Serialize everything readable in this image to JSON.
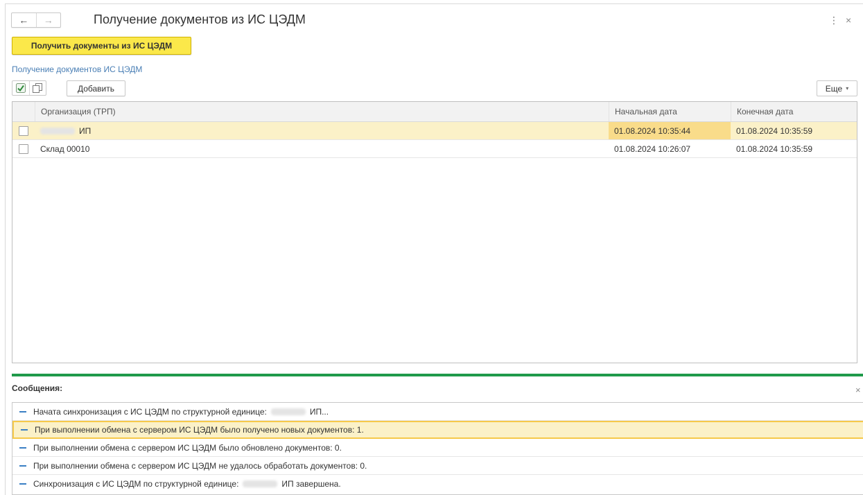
{
  "window": {
    "title": "Получение документов из ИС ЦЭДМ",
    "back_glyph": "←",
    "forward_glyph": "→",
    "more_glyph": "⋮",
    "close_glyph": "×"
  },
  "actions": {
    "main_button": "Получить документы из ИС ЦЭДМ",
    "section_link": "Получение документов ИС ЦЭДМ",
    "add_button": "Добавить",
    "more_button": "Еще",
    "more_caret": "▾"
  },
  "table": {
    "columns": [
      "Организация (ТРП)",
      "Начальная дата",
      "Конечная дата"
    ],
    "rows": [
      {
        "org": "ИП",
        "start": "01.08.2024 10:35:44",
        "end": "01.08.2024 10:35:59",
        "checked": false
      },
      {
        "org": "Склад 00010",
        "start": "01.08.2024 10:26:07",
        "end": "01.08.2024 10:35:59",
        "checked": false
      }
    ]
  },
  "messages": {
    "title": "Сообщения:",
    "close_glyph": "×",
    "items": [
      {
        "pre": "Начата синхронизация с ИС ЦЭДМ по структурной единице:",
        "post": "ИП..."
      },
      {
        "pre": "При выполнении обмена с сервером ИС ЦЭДМ было получено новых документов: 1.",
        "post": ""
      },
      {
        "pre": "При выполнении обмена с сервером ИС ЦЭДМ было обновлено документов: 0.",
        "post": ""
      },
      {
        "pre": "При выполнении обмена с сервером ИС ЦЭДМ не удалось обработать документов: 0.",
        "post": ""
      },
      {
        "pre": "Синхронизация с ИС ЦЭДМ по структурной единице:",
        "post": "ИП завершена."
      }
    ]
  },
  "colors": {
    "accent_yellow": "#fbe84a",
    "selection": "#fbf1c8",
    "green_line": "#1f9a4a",
    "link": "#4a7fb5"
  }
}
